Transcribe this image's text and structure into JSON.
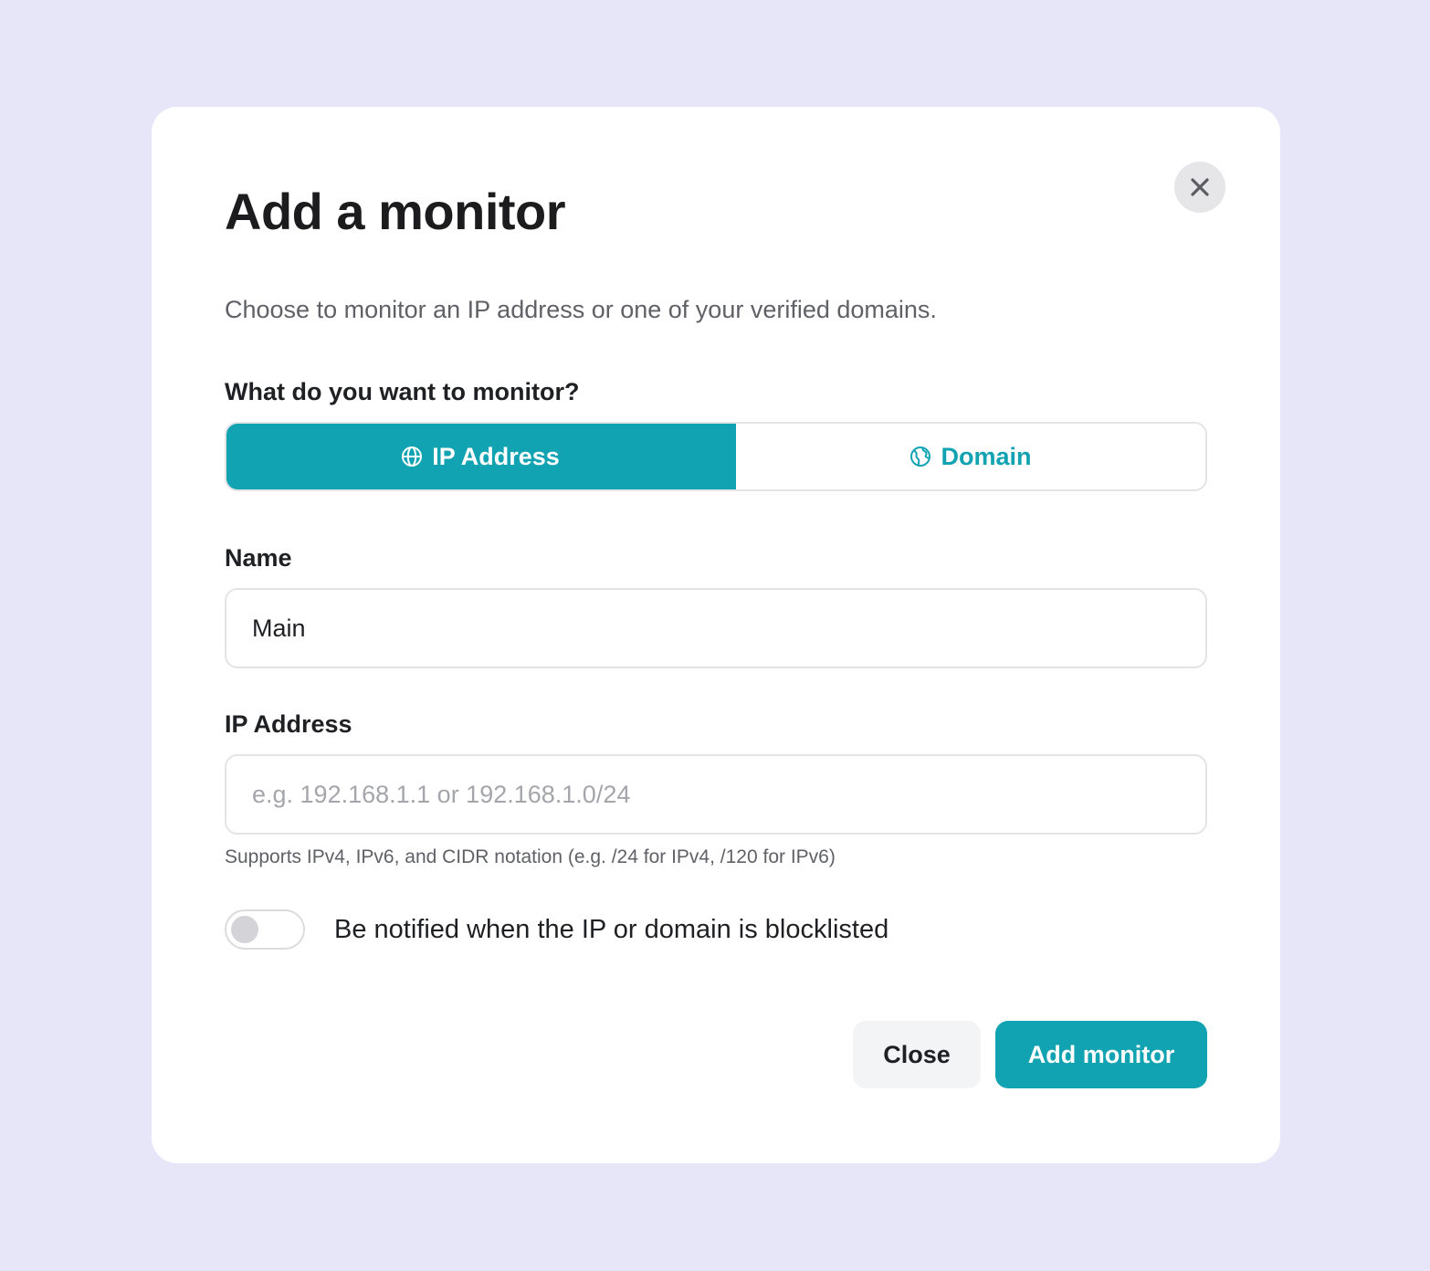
{
  "modal": {
    "title": "Add a monitor",
    "subtitle": "Choose to monitor an IP address or one of your verified domains.",
    "close_icon": "close-icon"
  },
  "monitor_type": {
    "label": "What do you want to monitor?",
    "options": [
      {
        "label": "IP Address",
        "icon": "globe-icon",
        "selected": true
      },
      {
        "label": "Domain",
        "icon": "earth-icon",
        "selected": false
      }
    ]
  },
  "name_field": {
    "label": "Name",
    "value": "Main"
  },
  "ip_field": {
    "label": "IP Address",
    "value": "",
    "placeholder": "e.g. 192.168.1.1 or 192.168.1.0/24",
    "help": "Supports IPv4, IPv6, and CIDR notation (e.g. /24 for IPv4, /120 for IPv6)"
  },
  "notify_toggle": {
    "label": "Be notified when the IP or domain is blocklisted",
    "on": false
  },
  "actions": {
    "close_label": "Close",
    "submit_label": "Add monitor"
  },
  "colors": {
    "accent": "#12a3b2",
    "background": "#e7e6f9"
  }
}
